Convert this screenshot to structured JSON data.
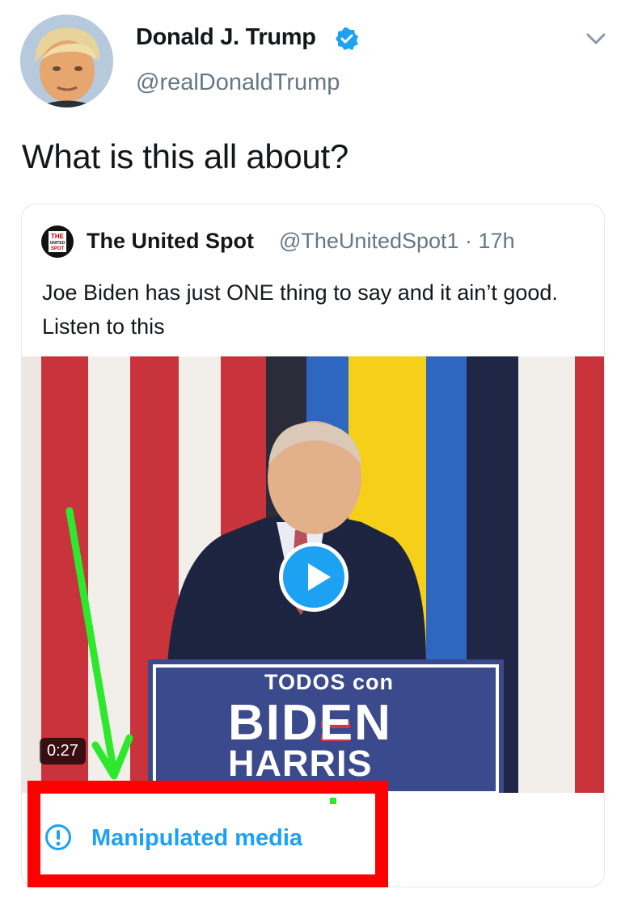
{
  "tweet": {
    "author_name": "Donald J. Trump",
    "author_handle": "@realDonaldTrump",
    "verified": true,
    "text": "What is this all about?"
  },
  "quoted_tweet": {
    "avatar_text": "THE UNITED SPOT",
    "author_name": "The United Spot",
    "author_handle": "@TheUnitedSpot1 · 17h",
    "text": "Joe Biden has just ONE thing to say and it ain’t good. Listen to this",
    "video": {
      "duration": "0:27",
      "sign": {
        "line1": "TODOS con",
        "line2": "BIDEN",
        "line3": "HARRIS"
      }
    },
    "label": "Manipulated media"
  },
  "colors": {
    "accent": "#1da1f2",
    "secondary_text": "#657786",
    "annotation_arrow": "#2ee82e",
    "annotation_box": "#ff0000"
  },
  "icons": [
    "verified-badge-icon",
    "chevron-down-icon",
    "play-icon",
    "exclamation-circle-icon"
  ]
}
